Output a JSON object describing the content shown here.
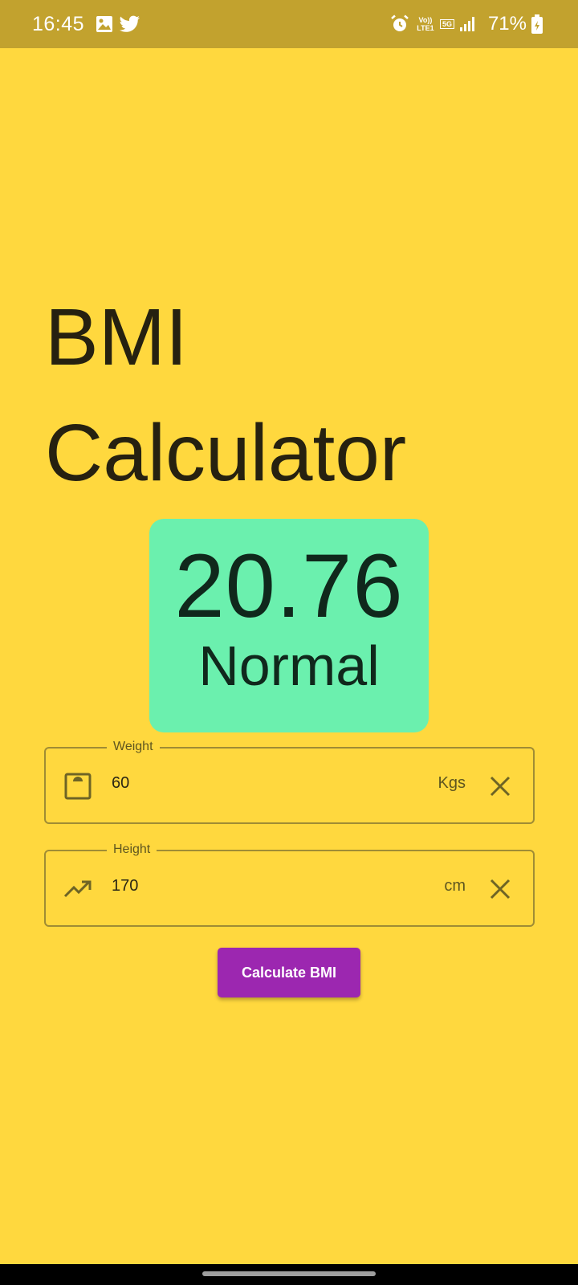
{
  "status_bar": {
    "time": "16:45",
    "network_top": "Vo)) LTE1",
    "network_5g": "5G",
    "battery": "71%",
    "icons": [
      "gallery-icon",
      "twitter-icon",
      "alarm-icon",
      "signal-icon",
      "battery-icon"
    ]
  },
  "app": {
    "title_line1": "BMI",
    "title_line2": "Calculator"
  },
  "result": {
    "value": "20.76",
    "status": "Normal",
    "color": "#6BF0AE"
  },
  "weight_field": {
    "label": "Weight",
    "value": "60",
    "unit": "Kgs",
    "icon": "scale-icon"
  },
  "height_field": {
    "label": "Height",
    "value": "170",
    "unit": "cm",
    "icon": "trending-up-icon"
  },
  "calculate_button": {
    "label": "Calculate BMI",
    "color": "#9C27B0"
  },
  "theme": {
    "background": "#FFD83E",
    "status_bar": "#C2A22E"
  }
}
